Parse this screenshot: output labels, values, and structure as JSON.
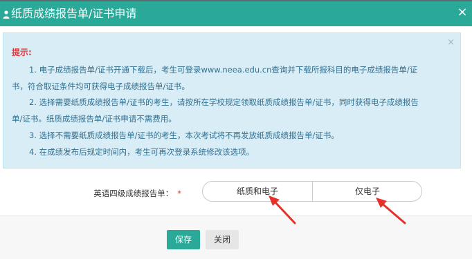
{
  "dialog": {
    "title": "纸质成绩报告单/证书申请",
    "close_glyph": "×",
    "header_color": "#2aa999"
  },
  "notice": {
    "dismiss_glyph": "×",
    "heading": "提示:",
    "lines": [
      "1. 电子成绩报告单/证书开通下载后，考生可登录www.neea.edu.cn查询并下载所报科目的电子成绩报告单/证",
      "书，符合取证条件均可获得电子成绩报告单/证书。",
      "2. 选择需要纸质成绩报告单/证书的考生，请按所在学校规定领取纸质成绩报告单/证书，同时获得电子成绩报告",
      "单/证书。纸质成绩报告单/证书申请不需费用。",
      "3. 选择不需要纸质成绩报告单/证书的考生，本次考试将不再发放纸质成绩报告单/证书。",
      "4. 在成绩发布后规定时间内，考生可再次登录系统修改该选项。"
    ]
  },
  "form": {
    "label": "英语四级成绩报告单：",
    "required_mark": "*",
    "options": [
      "纸质和电子",
      "仅电子"
    ]
  },
  "footer": {
    "save_label": "保存",
    "close_label": "关闭"
  },
  "colors": {
    "accent": "#2aa999",
    "notice_bg": "#d9edf7",
    "notice_text": "#31708f",
    "required": "#e2373b",
    "arrow": "#e8302a"
  }
}
